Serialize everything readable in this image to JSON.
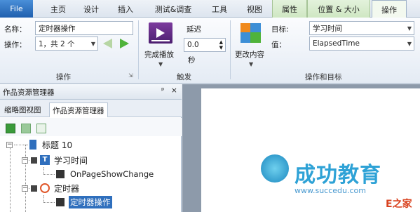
{
  "tabs": {
    "file": "File",
    "items": [
      "主页",
      "设计",
      "插入",
      "测试&调查",
      "工具",
      "视图",
      "属性",
      "位置 & 大小",
      "操作"
    ],
    "active": "操作"
  },
  "ribbon": {
    "name_label": "名称：",
    "name_value": "定时器操作",
    "action_label": "操作：",
    "action_value": "1，共 2 个",
    "group_action": "操作",
    "complete_play_label": "完成播放",
    "delay_label": "延迟",
    "delay_value": "0.0",
    "delay_unit": "秒",
    "group_trigger": "触发",
    "change_content_label": "更改内容",
    "target_label": "目标:",
    "target_value": "学习时间",
    "value_label": "值：",
    "value_value": "ElapsedTime",
    "group_action_target": "操作和目标"
  },
  "panel": {
    "title": "作品资源管理器",
    "pin": "ᵖ",
    "close": "×",
    "subtab_thumbnail": "缩略图视图",
    "subtab_explorer": "作品资源管理器"
  },
  "tree": {
    "title_node": "标题 10",
    "study_time": "学习时间",
    "onpageshow": "OnPageShowChange",
    "timer": "定时器",
    "timer_action": "定时器操作"
  },
  "watermark": {
    "brand": "成功教育",
    "url": "www.succedu.com",
    "corner": "E之家"
  },
  "colors": {
    "file_tab": "#2b6cbf",
    "context_tab": "#d6ecca",
    "selection": "#2f6fbd",
    "watermark": "#2ea2d6"
  }
}
